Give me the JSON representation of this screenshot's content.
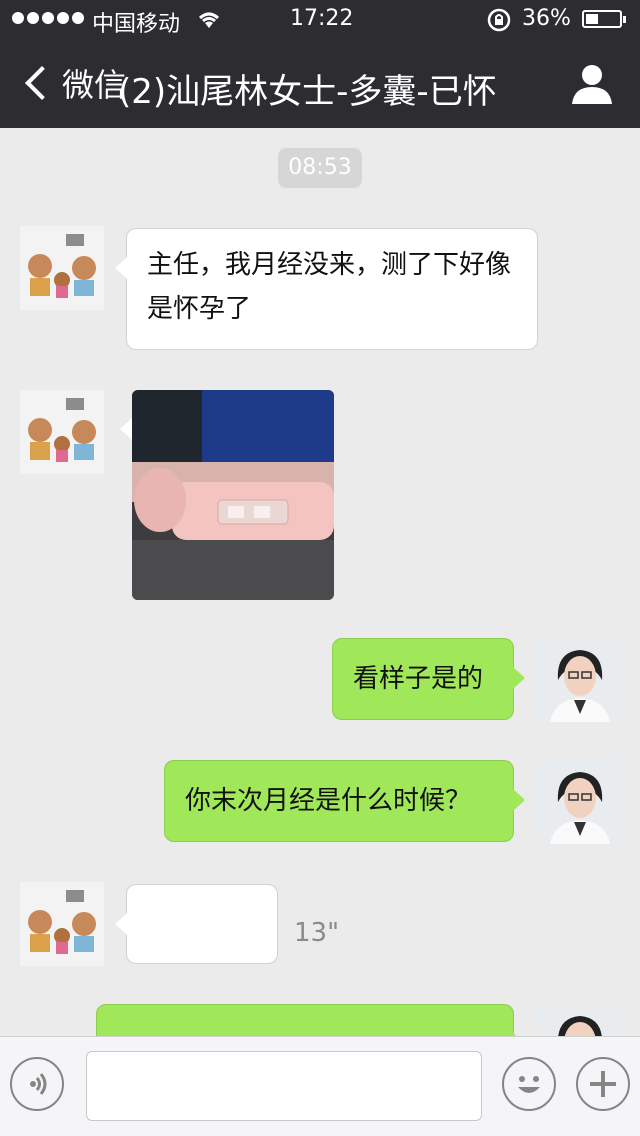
{
  "status_bar": {
    "carrier": "中国移动",
    "time": "17:22",
    "battery_percent_text": "36%",
    "battery_level": 0.36
  },
  "nav": {
    "back_label": "微信",
    "title": "(2)汕尾林女士-多囊-已怀",
    "colors": {
      "header_bg": "#2d2d31"
    }
  },
  "chat": {
    "timestamp": "08:53",
    "messages": [
      {
        "side": "left",
        "type": "text",
        "text": "主任，我月经没来，测了下好像是怀孕了"
      },
      {
        "side": "left",
        "type": "image",
        "description_icon": "pregnancy-test-photo"
      },
      {
        "side": "right",
        "type": "text",
        "text": "看样子是的"
      },
      {
        "side": "right",
        "type": "text",
        "text": "你末次月经是什么时候？"
      },
      {
        "side": "left",
        "type": "voice",
        "duration": "13\""
      },
      {
        "side": "right",
        "type": "text",
        "text": ""
      }
    ]
  },
  "input_bar": {
    "voice_icon": "voice-mode-icon",
    "emoji_icon": "emoji-icon",
    "plus_icon": "plus-icon"
  },
  "colors": {
    "sent_bubble": "#a0e75a",
    "received_bubble": "#ffffff",
    "chat_bg": "#ebebeb"
  }
}
